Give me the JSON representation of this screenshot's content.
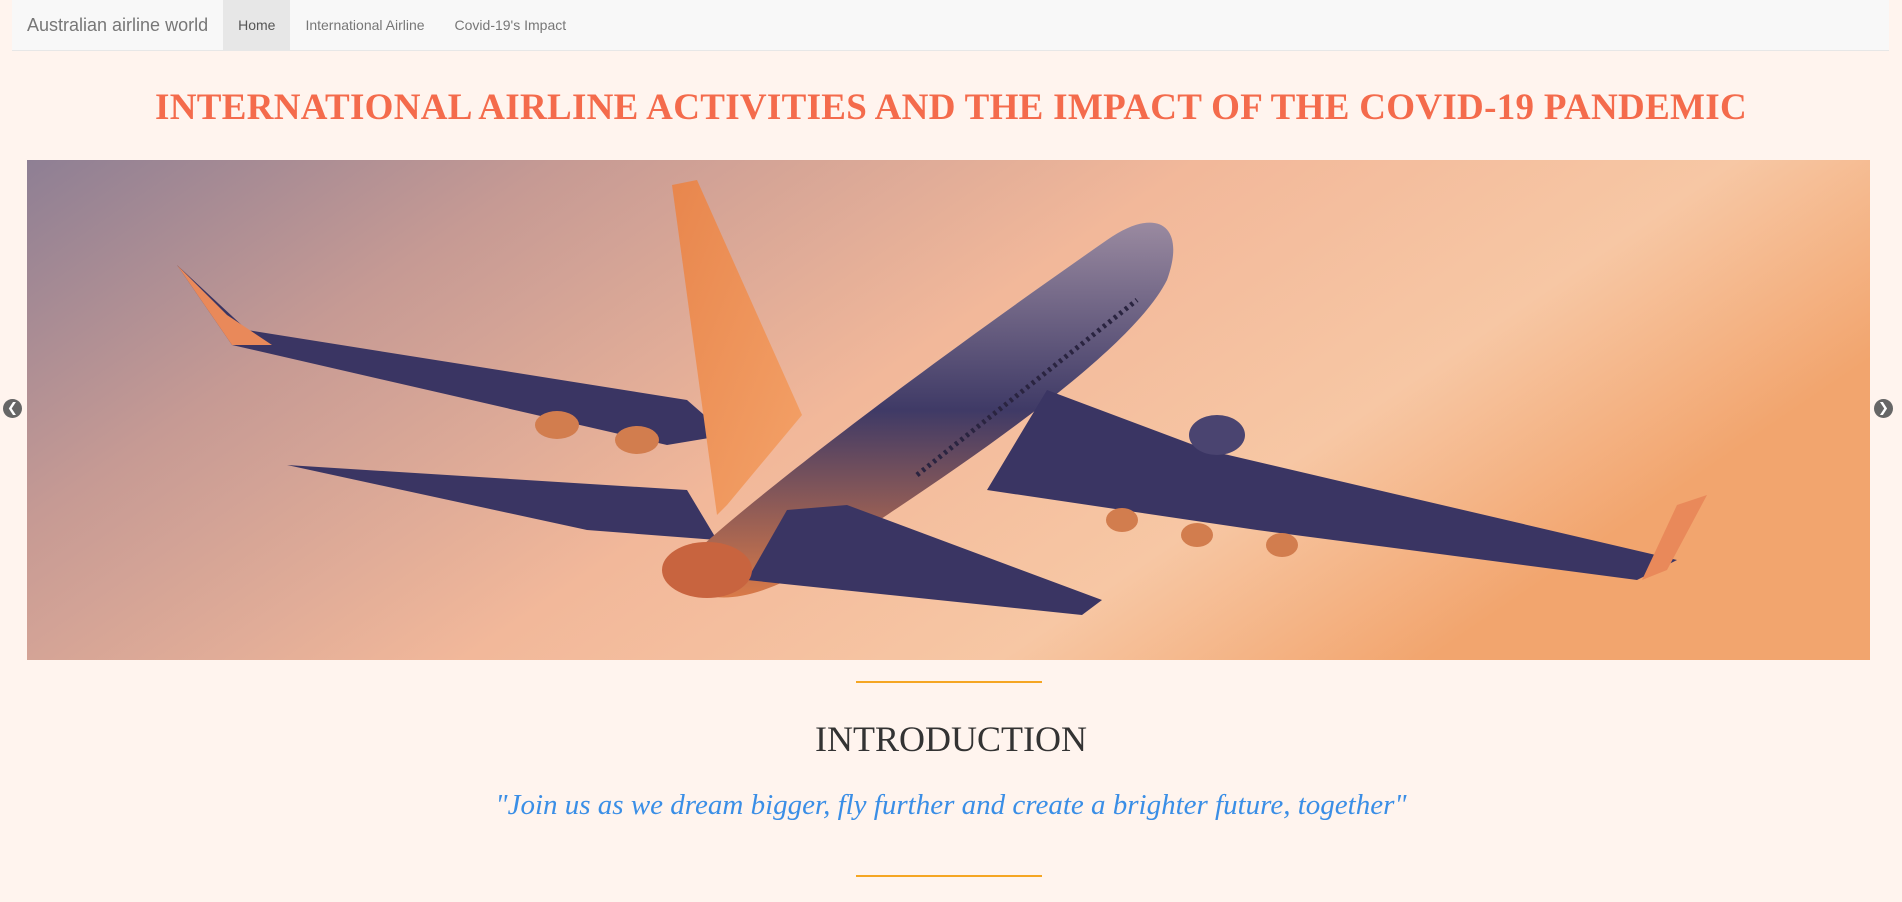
{
  "navbar": {
    "brand": "Australian airline world",
    "items": [
      {
        "label": "Home",
        "active": true
      },
      {
        "label": "International Airline",
        "active": false
      },
      {
        "label": "Covid-19's Impact",
        "active": false
      }
    ]
  },
  "page": {
    "title": "INTERNATIONAL AIRLINE ACTIVITIES AND THE IMPACT OF THE COVID-19 PANDEMIC"
  },
  "carousel": {
    "image": "airplane-at-sunset",
    "prev_icon": "chevron-left-icon",
    "next_icon": "chevron-right-icon"
  },
  "intro": {
    "heading": "INTRODUCTION",
    "quote": "\"Join us as we dream bigger, fly further and create a brighter future, together\""
  },
  "colors": {
    "background": "#fff4ee",
    "title": "#f46b4c",
    "quote": "#3a8ee6",
    "divider": "#f5a623"
  }
}
